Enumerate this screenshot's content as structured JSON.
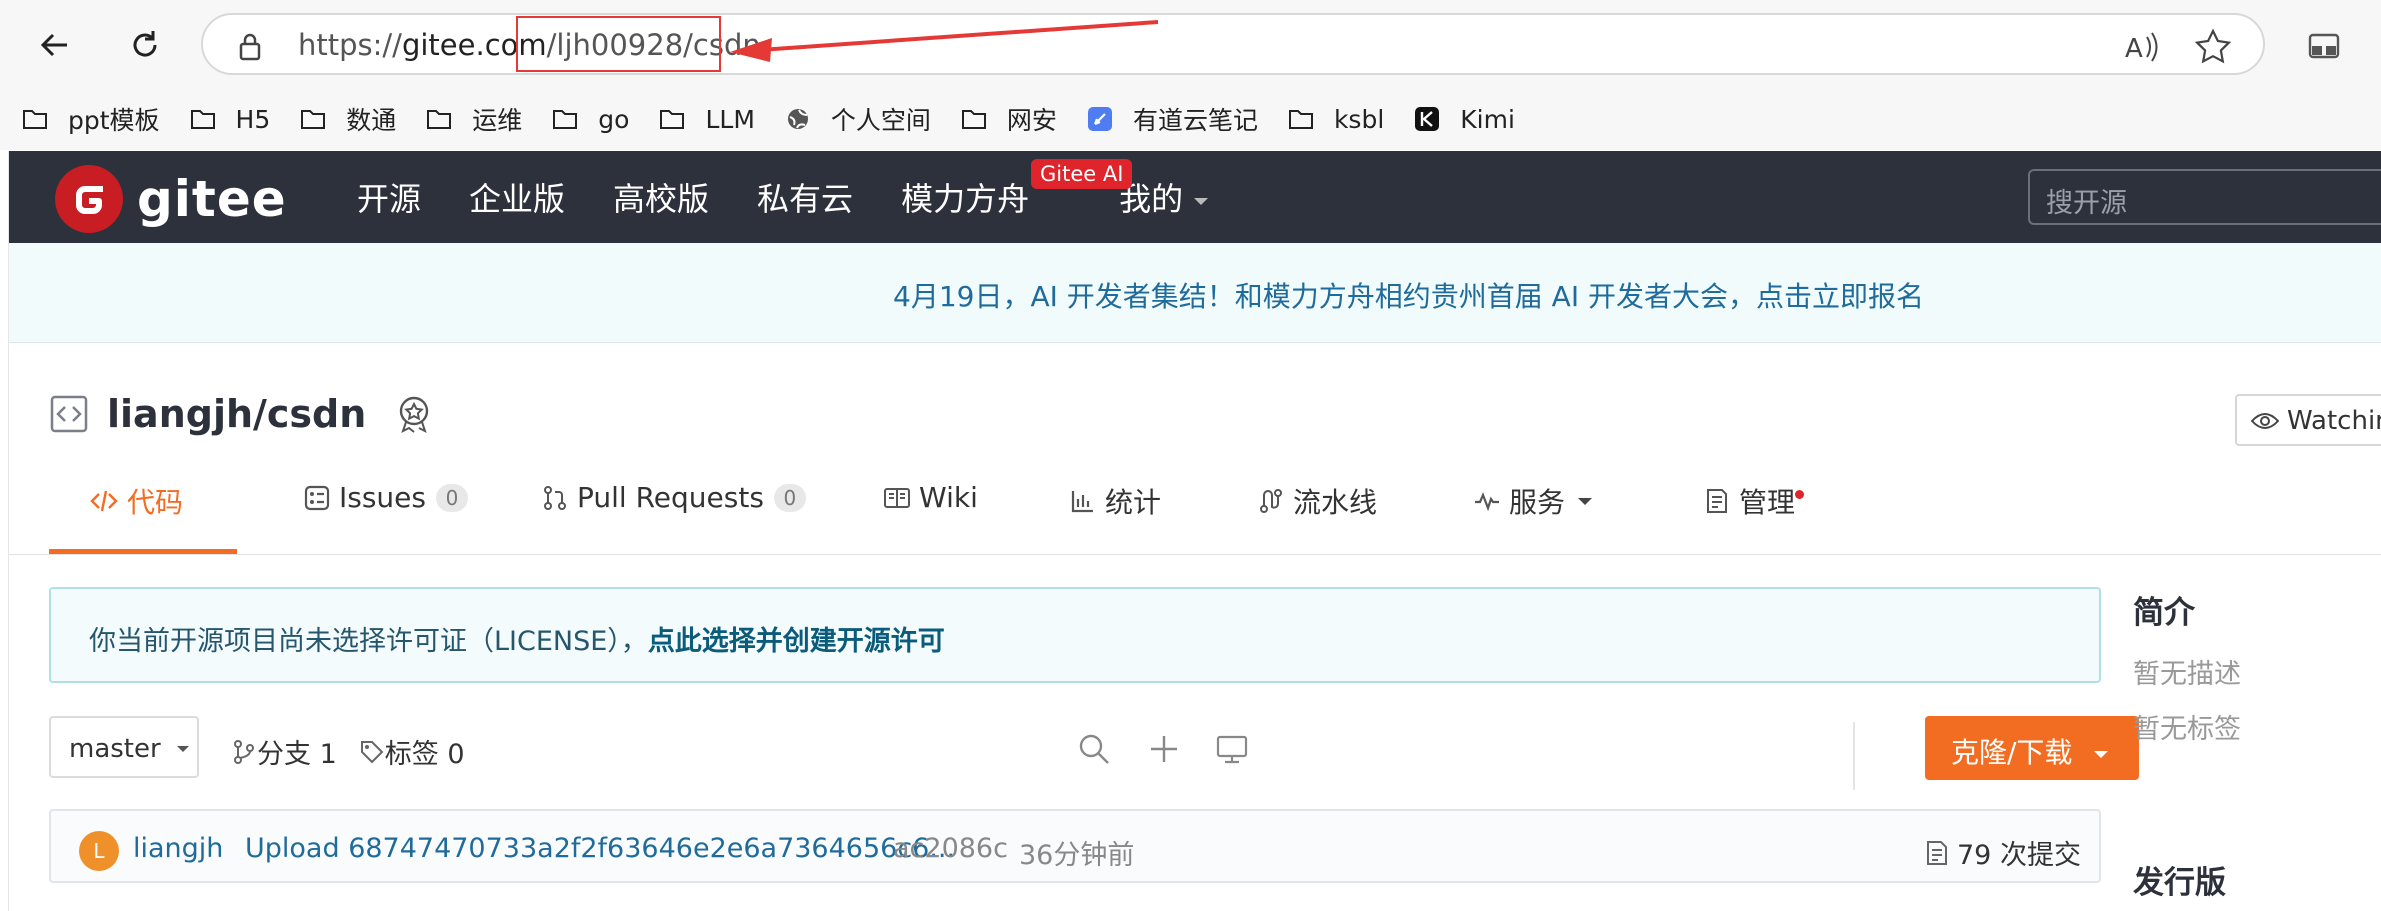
{
  "browser": {
    "url_scheme": "https://",
    "url_host": "gitee.com",
    "url_path": "/ljh00928/csdn",
    "bookmarks": [
      {
        "label": "ppt模板",
        "icon": "folder-icon"
      },
      {
        "label": "H5",
        "icon": "folder-icon"
      },
      {
        "label": "数通",
        "icon": "folder-icon"
      },
      {
        "label": "运维",
        "icon": "folder-icon"
      },
      {
        "label": "go",
        "icon": "folder-icon"
      },
      {
        "label": "LLM",
        "icon": "folder-icon"
      },
      {
        "label": "个人空间",
        "icon": "globe-icon"
      },
      {
        "label": "网安",
        "icon": "folder-icon"
      },
      {
        "label": "有道云笔记",
        "icon": "youdao-icon"
      },
      {
        "label": "ksbl",
        "icon": "folder-icon"
      },
      {
        "label": "Kimi",
        "icon": "kimi-icon"
      }
    ]
  },
  "nav": {
    "logo_text": "gitee",
    "items": [
      "开源",
      "企业版",
      "高校版",
      "私有云",
      "模力方舟",
      "我的"
    ],
    "ai_badge": "Gitee AI",
    "search_placeholder": "搜开源"
  },
  "banner": {
    "text": "4月19日，AI 开发者集结！和模力方舟相约贵州首届 AI 开发者大会，点击立即报名"
  },
  "repo": {
    "title": "liangjh/csdn",
    "watch_label": "Watching"
  },
  "tabs": [
    {
      "label": "代码",
      "active": true
    },
    {
      "label": "Issues",
      "count": "0"
    },
    {
      "label": "Pull Requests",
      "count": "0"
    },
    {
      "label": "Wiki"
    },
    {
      "label": "统计"
    },
    {
      "label": "流水线"
    },
    {
      "label": "服务"
    },
    {
      "label": "管理"
    }
  ],
  "license_notice": {
    "text": "你当前开源项目尚未选择许可证（LICENSE），",
    "link": "点此选择并创建开源许可"
  },
  "branch_bar": {
    "branch": "master",
    "branches_label": "分支 1",
    "tags_label": "标签 0",
    "clone_label": "克隆/下载"
  },
  "commit": {
    "avatar_letter": "L",
    "user": "liangjh",
    "message": "Upload 68747470733a2f2f63646e2e6a7364656c6...",
    "hash": "ac2086c",
    "time": "36分钟前",
    "count_label": "79 次提交"
  },
  "sidebar": {
    "intro_title": "简介",
    "no_desc": "暂无描述",
    "no_tags": "暂无标签",
    "release_title": "发行版"
  },
  "colors": {
    "accent": "#f26d21",
    "nav_bg": "#2d313b",
    "brand_red": "#c71d23",
    "annotation_red": "#e53935"
  }
}
